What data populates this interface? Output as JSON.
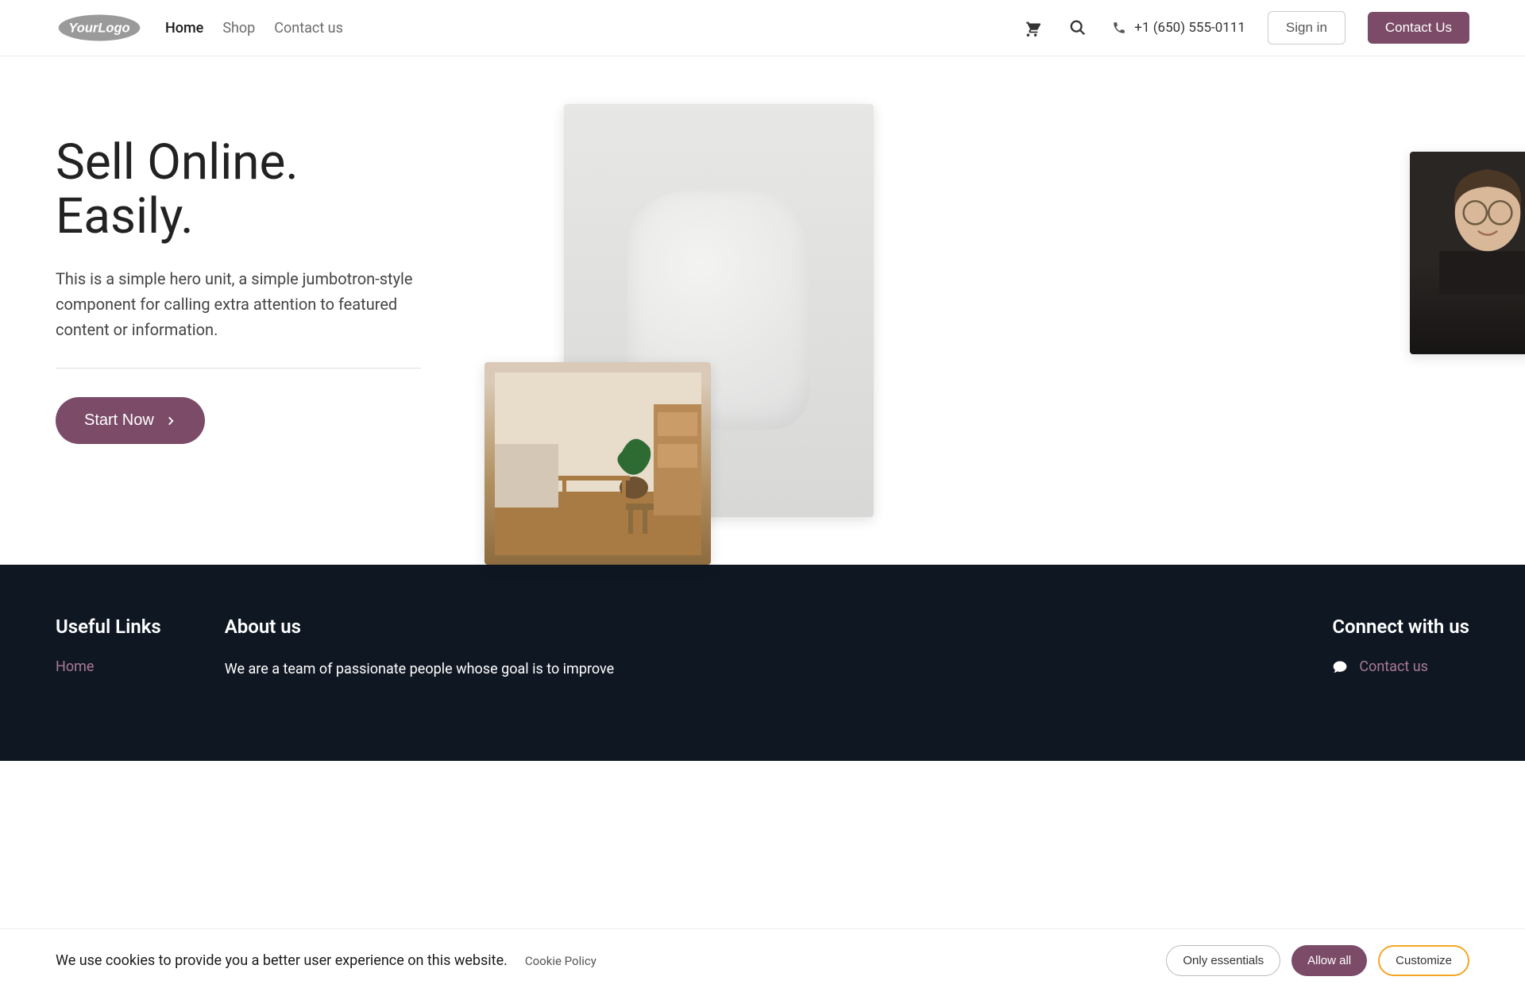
{
  "brand": {
    "name": "YourLogo"
  },
  "nav": {
    "items": [
      {
        "label": "Home",
        "active": true
      },
      {
        "label": "Shop",
        "active": false
      },
      {
        "label": "Contact us",
        "active": false
      }
    ]
  },
  "header": {
    "phone": "+1 (650) 555-0111",
    "signin_label": "Sign in",
    "contact_label": "Contact Us"
  },
  "hero": {
    "title_line1": "Sell Online.",
    "title_line2": "Easily.",
    "description": "This is a simple hero unit, a simple jumbotron-style component for calling extra attention to featured content or information.",
    "cta_label": "Start Now"
  },
  "footer": {
    "useful_title": "Useful Links",
    "useful_links": [
      {
        "label": "Home"
      }
    ],
    "about_title": "About us",
    "about_text": "We are a team of passionate people whose goal is to improve",
    "connect_title": "Connect with us",
    "connect_link": "Contact us"
  },
  "cookies": {
    "text": "We use cookies to provide you a better user experience on this website.",
    "policy_label": "Cookie Policy",
    "only_essentials": "Only essentials",
    "allow_all": "Allow all",
    "customize": "Customize"
  },
  "colors": {
    "accent": "#7b4b68",
    "footer_bg": "#0f1723",
    "highlight": "#f5a623"
  }
}
